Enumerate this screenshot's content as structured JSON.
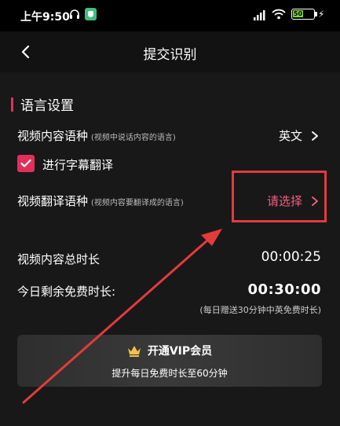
{
  "status_bar": {
    "time": "上午9:50",
    "battery": "50",
    "battery_level": 0.5,
    "battery_color": "#7bd83a"
  },
  "navbar": {
    "back_icon": "chevron-left-icon",
    "title": "提交识别"
  },
  "language_settings": {
    "section_title": "语言设置",
    "source_language": {
      "label": "视频内容语种",
      "hint": "(视频中说话内容的语言)",
      "value": "英文"
    },
    "subtitle_translate": {
      "label": "进行字幕翻译",
      "checked": true
    },
    "target_language": {
      "label": "视频翻译语种",
      "hint": "(视频内容要翻译成的语言)",
      "value": "请选择",
      "value_color": "#f0607f"
    }
  },
  "durations": {
    "total_label": "视频内容总时长",
    "total_value": "00:00:25",
    "free_label": "今日剩余免费时长:",
    "free_value": "00:30:00",
    "free_note": "(每日赠送30分钟中英免费时长)"
  },
  "vip": {
    "icon": "crown-icon",
    "title": "开通VIP会员",
    "subtitle": "提升每日免费时长至60分钟",
    "crown_color": "#f2c14e"
  },
  "annotation": {
    "color": "#e23b3b"
  }
}
